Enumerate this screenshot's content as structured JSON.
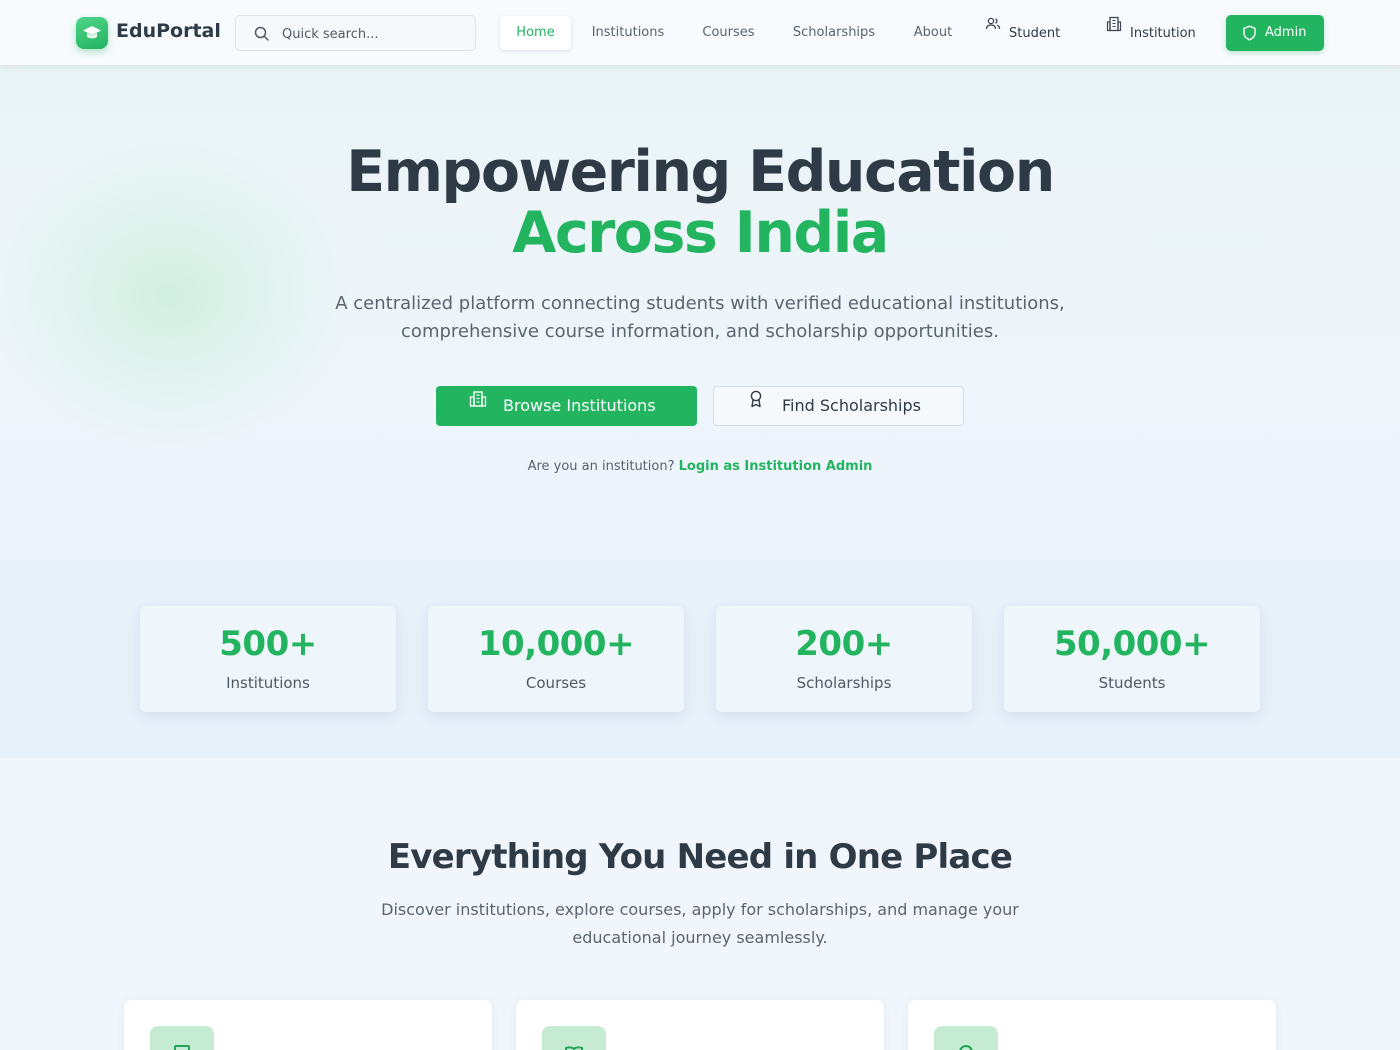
{
  "brand": {
    "name": "EduPortal",
    "logo_icon": "graduation-cap-icon"
  },
  "search": {
    "placeholder": "Quick search...",
    "icon": "search-icon"
  },
  "nav": {
    "items": [
      {
        "label": "Home",
        "active": true
      },
      {
        "label": "Institutions"
      },
      {
        "label": "Courses"
      },
      {
        "label": "Scholarships"
      },
      {
        "label": "About"
      }
    ],
    "student_label": "Student",
    "institution_label": "Institution",
    "admin_label": "Admin"
  },
  "hero": {
    "title_line1": "Empowering Education",
    "title_line2": "Across India",
    "subtitle_line1": "A centralized platform connecting students with verified educational institutions,",
    "subtitle_line2": "comprehensive course information, and scholarship opportunities.",
    "primary_button": "Browse Institutions",
    "secondary_button": "Find Scholarships",
    "institution_prompt": "Are you an institution?",
    "institution_link": "Login as Institution Admin"
  },
  "stats": [
    {
      "value": "500+",
      "label": "Institutions"
    },
    {
      "value": "10,000+",
      "label": "Courses"
    },
    {
      "value": "200+",
      "label": "Scholarships"
    },
    {
      "value": "50,000+",
      "label": "Students"
    }
  ],
  "features": {
    "title": "Everything You Need in One Place",
    "subtitle_line1": "Discover institutions, explore courses, apply for scholarships, and manage your",
    "subtitle_line2": "educational journey seamlessly.",
    "cards": [
      {
        "icon": "building-icon"
      },
      {
        "icon": "book-open-icon"
      },
      {
        "icon": "award-icon"
      }
    ]
  },
  "colors": {
    "accent": "#22b45f",
    "text": "#2e3a46",
    "muted": "#5b6570",
    "background": "#f1f6fc"
  }
}
